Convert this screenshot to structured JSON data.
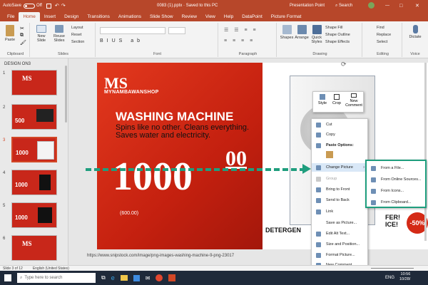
{
  "titlebar": {
    "autosave_label": "AutoSave",
    "autosave_state": "Off",
    "filename": "0083 (1).pptx  ·  Saved to this PC",
    "search_placeholder": "Search",
    "user": "Presentation Point",
    "minimize": "—",
    "maximize": "□",
    "close": "✕"
  },
  "tabs": [
    "File",
    "Home",
    "Insert",
    "Design",
    "Transitions",
    "Animations",
    "Slide Show",
    "Review",
    "View",
    "Help",
    "DataPoint",
    "Picture Format"
  ],
  "ribbon": {
    "clipboard": {
      "paste": "Paste",
      "label": "Clipboard"
    },
    "slides": {
      "new_slide": "New Slide",
      "reuse": "Reuse Slides",
      "layout": "Layout",
      "reset": "Reset",
      "section": "Section",
      "label": "Slides"
    },
    "font": {
      "label": "Font"
    },
    "paragraph": {
      "label": "Paragraph"
    },
    "drawing": {
      "shapes": "Shapes",
      "arrange": "Arrange",
      "quick_styles": "Quick Styles",
      "shape_fill": "Shape Fill",
      "shape_outline": "Shape Outline",
      "shape_effects": "Shape Effects",
      "label": "Drawing"
    },
    "editing": {
      "find": "Find",
      "replace": "Replace",
      "select": "Select",
      "label": "Editing"
    },
    "voice": {
      "dictate": "Dictate",
      "label": "Voice"
    }
  },
  "thumbnails": {
    "section": "DESIGN ON3",
    "items": [
      {
        "num": "1"
      },
      {
        "num": "2",
        "price": "500"
      },
      {
        "num": "3",
        "price": "1000"
      },
      {
        "num": "4",
        "price": "1000"
      },
      {
        "num": "5",
        "price": "1000"
      },
      {
        "num": "6"
      }
    ]
  },
  "slide": {
    "brand": "MYNAMBAWANSHOP",
    "logo": "MS",
    "headline": "WASHING MACHINE",
    "tagline": "Spins like no other. Cleans everything. Saves water and electricity.",
    "price": "1000",
    "cents": "00",
    "old_price": "(600.00)",
    "bottom_text": "DETERGEN",
    "offer_text": "FER!",
    "offer_text2": "ICE!",
    "discount": "-50%",
    "url": "https://www.snipstock.com/image/png-images-washing-machine-9-png-23017"
  },
  "mini_toolbar": {
    "style": "Style",
    "crop": "Crop",
    "new_comment": "New Comment"
  },
  "context_menu": {
    "items": [
      {
        "label": "Cut",
        "disabled": false
      },
      {
        "label": "Copy",
        "disabled": false
      },
      {
        "label": "Paste Options:",
        "disabled": false
      },
      {
        "label": "Change Picture",
        "disabled": false
      },
      {
        "label": "Group",
        "disabled": true
      },
      {
        "label": "Bring to Front",
        "disabled": false
      },
      {
        "label": "Send to Back",
        "disabled": false
      },
      {
        "label": "Link",
        "disabled": false
      },
      {
        "label": "Save as Picture...",
        "disabled": false
      },
      {
        "label": "Edit Alt Text...",
        "disabled": false
      },
      {
        "label": "Size and Position...",
        "disabled": false
      },
      {
        "label": "Format Picture...",
        "disabled": false
      },
      {
        "label": "New Comment",
        "disabled": false
      }
    ]
  },
  "submenu": {
    "items": [
      "From a File...",
      "From Online Sources...",
      "From Icons...",
      "From Clipboard..."
    ]
  },
  "statusbar": {
    "slide_info": "Slide 3 of 12",
    "language": "English (United States)"
  },
  "taskbar": {
    "search_placeholder": "Type here to search",
    "lang": "ENG",
    "time": "10:56",
    "date": "10/28/"
  },
  "colors": {
    "accent": "#b7472a",
    "banner": "#d42a16",
    "highlight": "#1f9e7e"
  }
}
